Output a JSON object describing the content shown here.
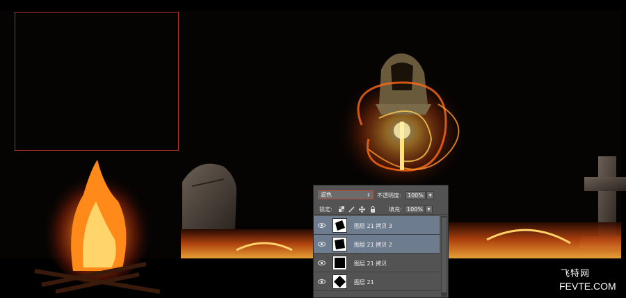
{
  "layers_panel": {
    "blend_mode": "滤色",
    "opacity_label": "不透明度:",
    "opacity_value": "100%",
    "lock_label": "锁定:",
    "fill_label": "填充:",
    "fill_value": "100%",
    "layers": [
      {
        "name": "图层 21 拷贝 3",
        "selected": true
      },
      {
        "name": "图层 21 拷贝 2",
        "selected": true
      },
      {
        "name": "图层 21 拷贝",
        "selected": false
      },
      {
        "name": "图层 21",
        "selected": false
      }
    ]
  },
  "watermark": {
    "chinese": "飞特网",
    "english": "FEVTE.COM"
  },
  "colors": {
    "selection_border": "#b0302a",
    "selected_layer": "#6e7c90",
    "panel_bg": "#535353"
  }
}
